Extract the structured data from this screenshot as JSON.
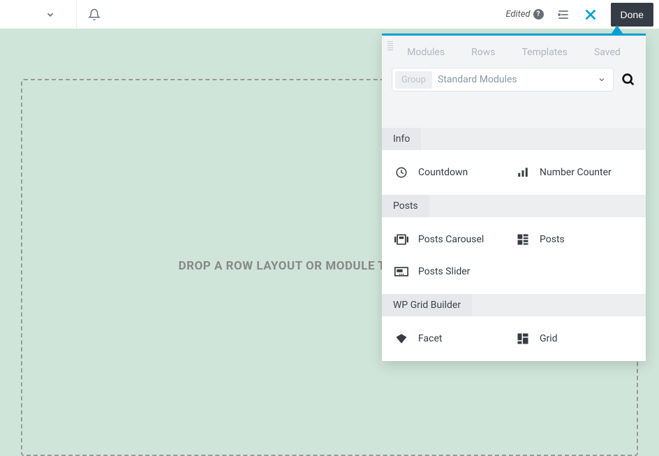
{
  "topbar": {
    "edited_label": "Edited",
    "done_label": "Done"
  },
  "canvas": {
    "drop_text": "DROP A ROW LAYOUT OR MODULE TO GET STARTED!"
  },
  "panel": {
    "tabs": [
      "Modules",
      "Rows",
      "Templates",
      "Saved"
    ],
    "group_label": "Group",
    "group_value": "Standard Modules",
    "categories": [
      {
        "name": "Info",
        "items": [
          {
            "label": "Countdown",
            "icon": "clock-icon"
          },
          {
            "label": "Number Counter",
            "icon": "bars-icon"
          }
        ]
      },
      {
        "name": "Posts",
        "items": [
          {
            "label": "Posts Carousel",
            "icon": "carousel-icon"
          },
          {
            "label": "Posts",
            "icon": "posts-grid-icon"
          },
          {
            "label": "Posts Slider",
            "icon": "slider-icon"
          }
        ]
      },
      {
        "name": "WP Grid Builder",
        "items": [
          {
            "label": "Facet",
            "icon": "diamond-icon"
          },
          {
            "label": "Grid",
            "icon": "grid-icon"
          }
        ]
      }
    ]
  }
}
